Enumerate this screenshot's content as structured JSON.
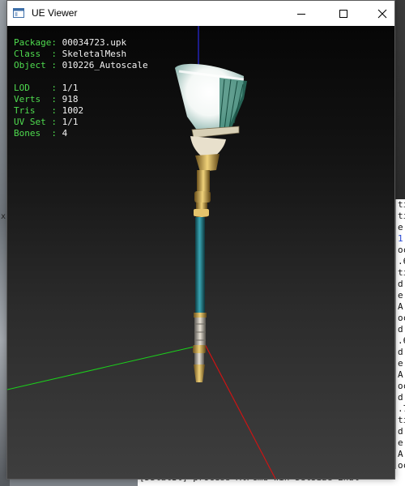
{
  "window": {
    "title": "UE Viewer",
    "icon": "app-window-icon",
    "controls": [
      "minimize-icon",
      "maximize-icon",
      "close-icon"
    ]
  },
  "info": {
    "package": {
      "label": "Package:",
      "value": "00034723.upk"
    },
    "class": {
      "label": "Class  :",
      "value": "SkeletalMesh"
    },
    "object": {
      "label": "Object :",
      "value": "010226_Autoscale"
    },
    "lod": {
      "label": "LOD    :",
      "value": "1/1"
    },
    "verts": {
      "label": "Verts  :",
      "value": "918"
    },
    "tris": {
      "label": "Tris   :",
      "value": "1002"
    },
    "uvset": {
      "label": "UV Set :",
      "value": "1/1"
    },
    "bones": {
      "label": "Bones  :",
      "value": "4"
    }
  },
  "colors": {
    "info_label": "#4fdc4f",
    "info_value": "#f2f2f2",
    "axis_x": "#cc1414",
    "axis_y": "#1bd11b",
    "axis_z": "#2a2adf",
    "handle_teal": "#1f7a86",
    "gold": "#c9a24a"
  },
  "background_console": {
    "lines": [
      "ti",
      "ti",
      "e",
      "1",
      "oc",
      ".6",
      "ti",
      "d",
      "e",
      "A",
      "oc",
      "d",
      ".6",
      "d",
      "e",
      "A",
      "oc",
      "d",
      ".7",
      "ti",
      "d",
      "e",
      "A",
      "oc",
      "d",
      ".",
      "e"
    ],
    "bottom_line": "[DStatIl] process  AlPcmd win SetSize  Endl"
  },
  "desktop": {
    "left_mark": "x"
  }
}
